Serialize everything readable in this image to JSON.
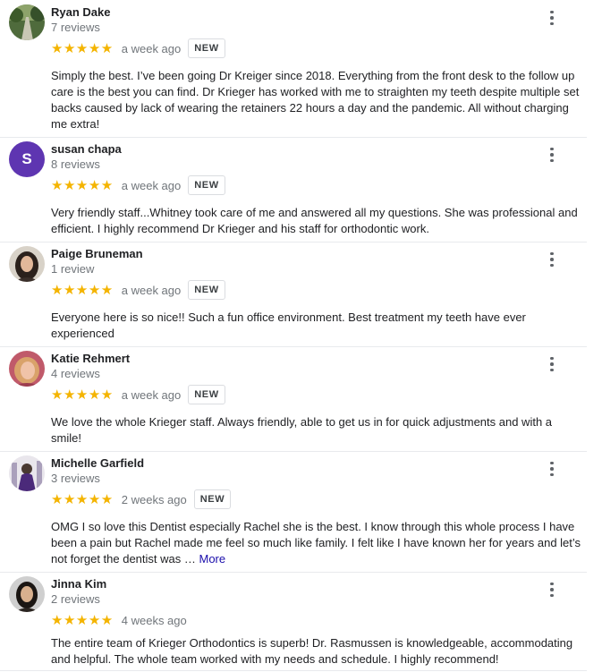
{
  "reviews": [
    {
      "name": "Ryan Dake",
      "count": "7 reviews",
      "stars": "★★★★★",
      "rating": 5,
      "date": "a week ago",
      "badge": "NEW",
      "text": "Simply the best.  I’ve been going Dr Kreiger since 2018.  Everything from the front desk to the follow up care is the best you can find.  Dr Krieger has worked with me to straighten my teeth despite multiple set backs caused by lack of wearing the retainers 22 hours a day and the pandemic.  All without charging me extra!",
      "more": ""
    },
    {
      "name": "susan chapa",
      "count": "8 reviews",
      "avatar_letter": "S",
      "avatar_color": "#5e35b1",
      "stars": "★★★★★",
      "rating": 5,
      "date": "a week ago",
      "badge": "NEW",
      "text": "Very friendly staff...Whitney took care of me and answered all my questions.  She was professional and efficient.  I highly recommend Dr Krieger and his staff for orthodontic work.",
      "more": ""
    },
    {
      "name": "Paige Bruneman",
      "count": "1 review",
      "stars": "★★★★★",
      "rating": 5,
      "date": "a week ago",
      "badge": "NEW",
      "text": "Everyone here is so nice!! Such a fun office environment. Best treatment my teeth have ever experienced",
      "more": ""
    },
    {
      "name": "Katie Rehmert",
      "count": "4 reviews",
      "stars": "★★★★★",
      "rating": 5,
      "date": "a week ago",
      "badge": "NEW",
      "text": "We love the whole Krieger staff.  Always friendly, able to get us in for quick adjustments and with a smile!",
      "more": ""
    },
    {
      "name": "Michelle Garfield",
      "count": "3 reviews",
      "stars": "★★★★★",
      "rating": 5,
      "date": "2 weeks ago",
      "badge": "NEW",
      "text": "OMG I so love this Dentist especially Rachel she is the best. I know through this whole process I have been a pain but Rachel made me feel so much like family. I felt like I have known her for years and let’s not forget the dentist was … ",
      "more": "More"
    },
    {
      "name": "Jinna Kim",
      "count": "2 reviews",
      "stars": "★★★★★",
      "rating": 5,
      "date": "4 weeks ago",
      "badge": "",
      "text": "The entire team of Krieger Orthodontics is superb!  Dr. Rasmussen is knowledgeable, accommodating and helpful.  The whole team worked with my needs and schedule.  I highly recommend!",
      "more": ""
    }
  ],
  "colors": {
    "star": "#f4b400",
    "link": "#1a0dab",
    "secondary_text": "#70757a"
  },
  "icons": {
    "menu": "more-vert-icon",
    "star": "star-icon"
  }
}
